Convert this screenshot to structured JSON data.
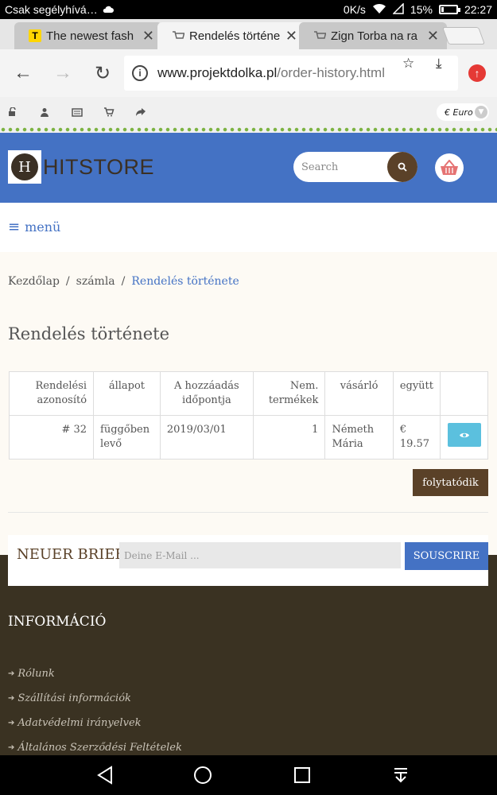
{
  "status_bar": {
    "carrier": "Csak segélyhívá…",
    "speed": "0K/s",
    "battery": "15%",
    "battery_level": 0.15,
    "time": "22:27"
  },
  "tabs": [
    {
      "title": "The newest fash",
      "favicon": "T",
      "active": false
    },
    {
      "title": "Rendelés történe",
      "favicon": "cart-icon",
      "active": true
    },
    {
      "title": "Zign Torba na ra",
      "favicon": "cart-icon",
      "active": false
    }
  ],
  "address_bar": {
    "domain": "www.projektdolka.pl",
    "path": "/order-history.html"
  },
  "top_bar": {
    "currency": "€ Euro"
  },
  "header": {
    "logo_mark": "H",
    "logo_text": "HITSTORE",
    "search_placeholder": "Search"
  },
  "menu": {
    "label": "menü"
  },
  "breadcrumb": {
    "home": "Kezdőlap",
    "account": "számla",
    "current": "Rendelés története",
    "separator": "/"
  },
  "page": {
    "title": "Rendelés története"
  },
  "orders_table": {
    "headers": {
      "id": [
        "Rendelési",
        "azonosító"
      ],
      "status": [
        "állapot"
      ],
      "date": [
        "A hozzáadás",
        "időpontja"
      ],
      "qty": [
        "Nem.",
        "termékek"
      ],
      "customer": [
        "vásárló"
      ],
      "total": [
        "együtt"
      ]
    },
    "rows": [
      {
        "id": "# 32",
        "status": [
          "függőben",
          "levő"
        ],
        "date": "2019/03/01",
        "qty": "1",
        "customer": [
          "Németh",
          "Mária"
        ],
        "total": "€ 19.57"
      }
    ]
  },
  "continue_label": "folytatódik",
  "newsletter": {
    "label": "NEUER BRIEF",
    "placeholder": "Deine E-Mail ...",
    "button": "SOUSCRIRE"
  },
  "footer": {
    "title": "INFORMÁCIÓ",
    "links": [
      "Rólunk",
      "Szállítási információk",
      "Adatvédelmi irányelvek",
      "Általános Szerződési Feltételek"
    ]
  },
  "colors": {
    "header_blue": "#4472c4",
    "brand_brown": "#5a4128",
    "footer_dark": "#3a3222",
    "view_button": "#5bc0de"
  }
}
